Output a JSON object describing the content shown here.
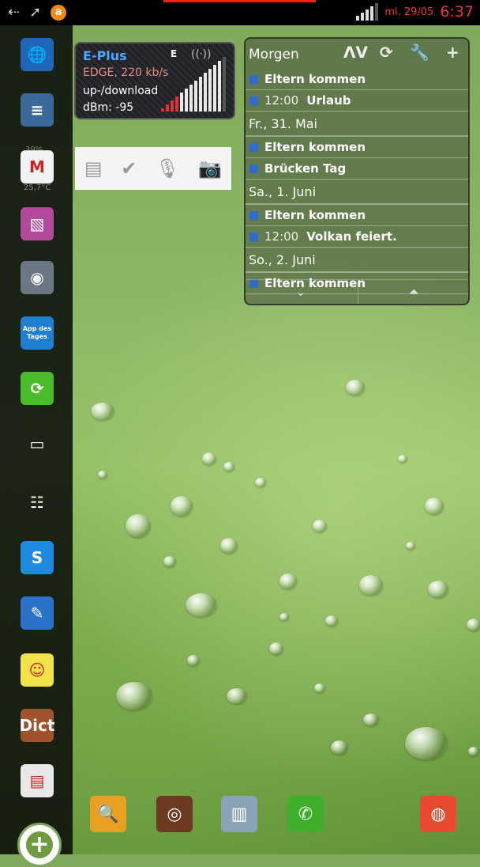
{
  "status_bar": {
    "date": "mi. 29/05",
    "time": "6:37",
    "accent_color": "#e33333",
    "icons": [
      "usb-icon",
      "send-icon",
      "avast-icon",
      "signal-icon"
    ]
  },
  "signal_widget": {
    "carrier": "E-Plus",
    "network": "EDGE, 220 kb/s",
    "mode": "up-/download",
    "dbm": "dBm: -95",
    "badge": "E",
    "strength_fraction": 0.9
  },
  "note_widget": {
    "icons": [
      "note-icon",
      "check-icon",
      "mic-icon",
      "camera-icon"
    ]
  },
  "calendar": {
    "title": "Morgen",
    "tools": [
      "sort-icon",
      "refresh-icon",
      "wrench-icon",
      "plus-icon"
    ],
    "rows": [
      {
        "type": "event",
        "time": "",
        "title": "Eltern kommen"
      },
      {
        "type": "event",
        "time": "12:00",
        "title": "Urlaub"
      },
      {
        "type": "day",
        "label": "Fr., 31. Mai"
      },
      {
        "type": "event",
        "time": "",
        "title": "Eltern kommen"
      },
      {
        "type": "event",
        "time": "",
        "title": "Brücken Tag"
      },
      {
        "type": "day",
        "label": "Sa., 1. Juni"
      },
      {
        "type": "event",
        "time": "",
        "title": "Eltern kommen"
      },
      {
        "type": "event",
        "time": "12:00",
        "title": "Volkan feiert."
      },
      {
        "type": "day",
        "label": "So., 2. Juni"
      },
      {
        "type": "event",
        "time": "",
        "title": "Eltern kommen"
      }
    ],
    "footer": [
      "chevron-down-icon",
      "scroll-top-icon"
    ]
  },
  "sidebar": {
    "faint_labels": [
      "39%",
      "25,7°C"
    ],
    "apps": [
      {
        "name": "globe-app-icon",
        "glyph": "🌐",
        "bg": "#1d66b8"
      },
      {
        "name": "settings-app-icon",
        "glyph": "≡",
        "bg": "#3b6a9a"
      },
      {
        "name": "gmail-app-icon",
        "glyph": "M",
        "bg": "#f2f2f2"
      },
      {
        "name": "gallery-app-icon",
        "glyph": "▧",
        "bg": "#b04a9a"
      },
      {
        "name": "camera-app-icon",
        "glyph": "◉",
        "bg": "#6b7784"
      },
      {
        "name": "app-des-tages-icon",
        "glyph": "App des Tages",
        "bg": "#1f7fd1"
      },
      {
        "name": "sync-app-icon",
        "glyph": "⟳",
        "bg": "#4cbb2a"
      },
      {
        "name": "multitask-app-icon",
        "glyph": "▭",
        "bg": "transparent"
      },
      {
        "name": "board-app-icon",
        "glyph": "☷",
        "bg": "transparent"
      },
      {
        "name": "navigation-app-icon",
        "glyph": "S",
        "bg": "#1e8ae0"
      },
      {
        "name": "notes-app-icon",
        "glyph": "✎",
        "bg": "#2a73c8"
      },
      {
        "name": "sticky-note-app-icon",
        "glyph": "☺",
        "bg": "#f2e24a"
      },
      {
        "name": "dict-app-icon",
        "glyph": "Dict",
        "bg": "#a0522d"
      },
      {
        "name": "news-app-icon",
        "glyph": "▤",
        "bg": "#e8e8e8"
      }
    ]
  },
  "dock": [
    {
      "name": "map-search-app-icon",
      "glyph": "🔍",
      "bg": "#e8a020"
    },
    {
      "name": "camera-lens-app-icon",
      "glyph": "◎",
      "bg": "#6b3a20"
    },
    {
      "name": "color-app-icon",
      "glyph": "▥",
      "bg": "#8aa3b8"
    },
    {
      "name": "phone-app-icon",
      "glyph": "✆",
      "bg": "#3fae2a"
    },
    {
      "name": "chrome-app-icon",
      "glyph": "◍",
      "bg": "#e84a30"
    }
  ]
}
